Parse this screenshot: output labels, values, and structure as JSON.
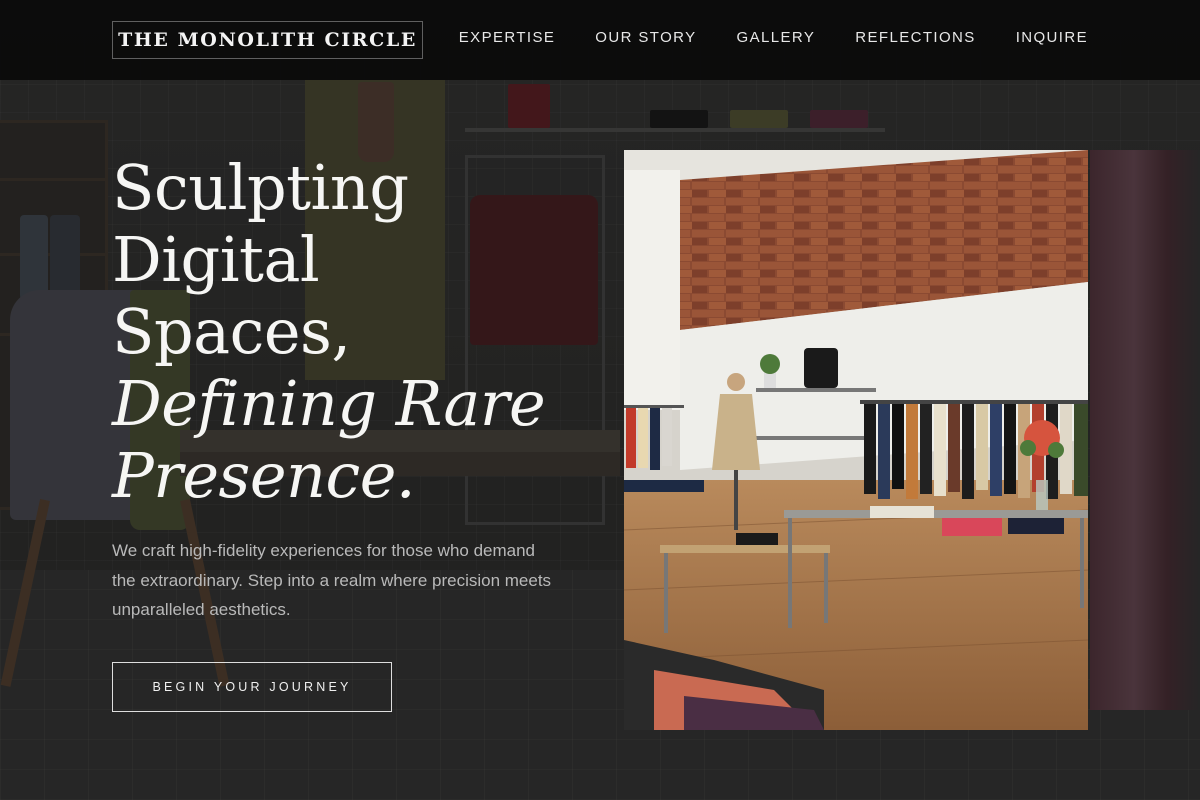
{
  "brand": {
    "name": "THE MONOLITH CIRCLE"
  },
  "nav": {
    "items": [
      {
        "label": "EXPERTISE"
      },
      {
        "label": "OUR STORY"
      },
      {
        "label": "GALLERY"
      },
      {
        "label": "REFLECTIONS"
      },
      {
        "label": "INQUIRE"
      }
    ]
  },
  "hero": {
    "title_lines": [
      "Sculpting",
      "Digital",
      "Spaces,"
    ],
    "title_italic_lines": [
      "Defining Rare",
      "Presence."
    ],
    "description": "We craft high-fidelity experiences for those who demand the extraordinary. Step into a realm where precision meets unparalleled aesthetics.",
    "cta_label": "BEGIN YOUR JOURNEY"
  },
  "colors": {
    "nav_bg": "#0a0a0a",
    "text_primary": "#f6f6f4",
    "text_muted": "#b9b9b9",
    "accent_brick": "#8b4a32"
  }
}
